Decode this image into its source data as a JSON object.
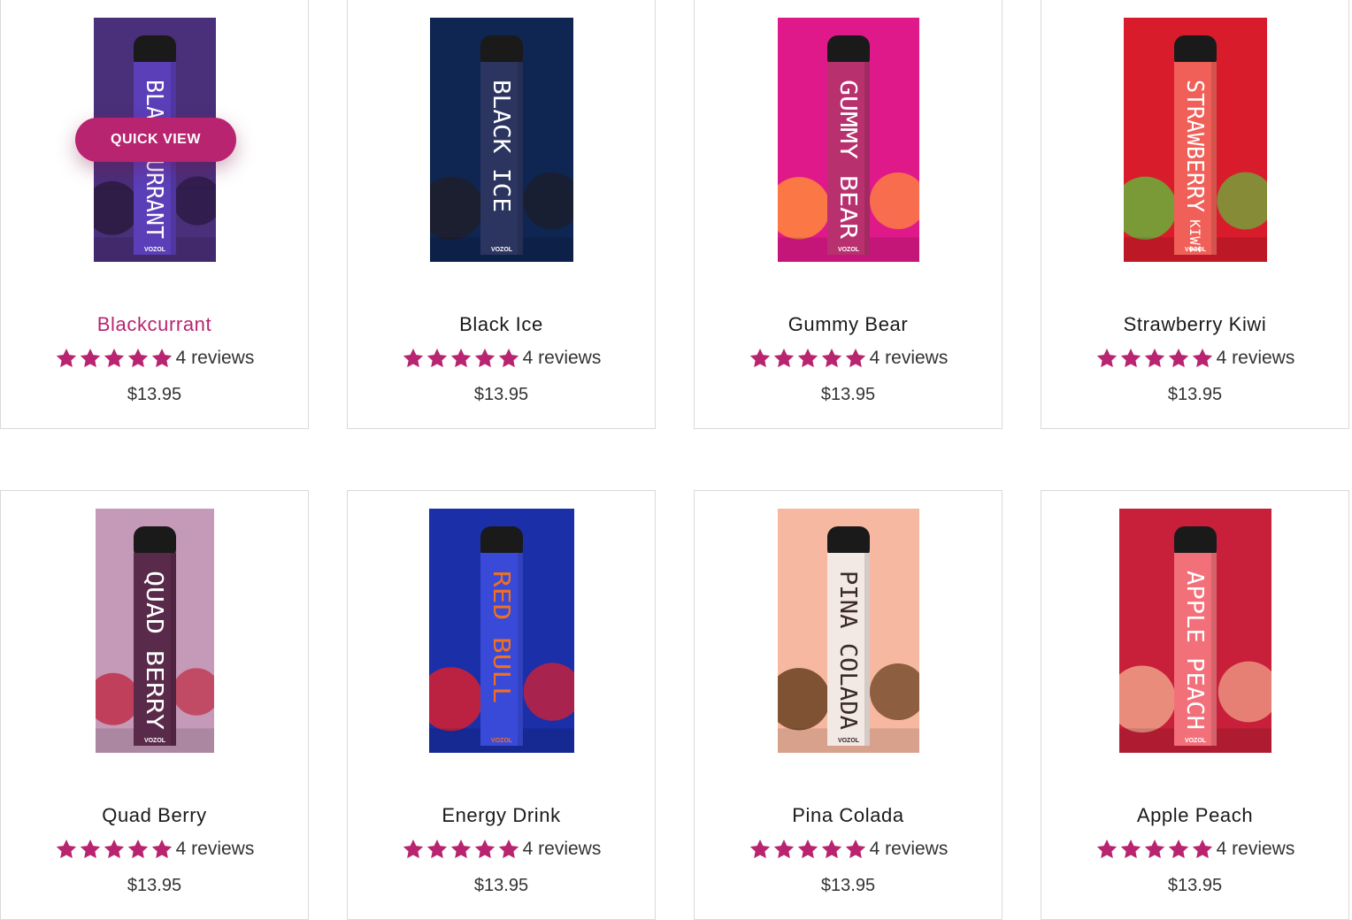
{
  "quick_view_label": "QUICK VIEW",
  "accent_color": "#b8246f",
  "rating_value": 5,
  "products": [
    {
      "name": "Blackcurrant",
      "reviews": "4 reviews",
      "price": "$13.95",
      "pen_text": "BLACKCURRANT",
      "brand": "VOZOL",
      "bg": "#4a2f7a",
      "pen": "#5a3fb8",
      "text_color": "#ffffff",
      "accent": "#2a1a40",
      "highlighted": true
    },
    {
      "name": "Black Ice",
      "reviews": "4 reviews",
      "price": "$13.95",
      "pen_text": "BLACK ICE",
      "brand": "VOZOL",
      "bg": "#0f2552",
      "pen": "#2b3560",
      "text_color": "#ffffff",
      "accent": "#1e1e2a",
      "highlighted": false
    },
    {
      "name": "Gummy Bear",
      "reviews": "4 reviews",
      "price": "$13.95",
      "pen_text": "GUMMY BEAR",
      "brand": "VOZOL",
      "bg": "#e0198a",
      "pen": "#b8306e",
      "text_color": "#ffffff",
      "accent": "#ff8a3a",
      "highlighted": false
    },
    {
      "name": "Strawberry Kiwi",
      "reviews": "4 reviews",
      "price": "$13.95",
      "pen_text": "STRAWBERRY",
      "pen_sub": "KIWI",
      "brand": "VOZOL",
      "bg": "#d81c2c",
      "pen": "#f06058",
      "text_color": "#ffffff",
      "accent": "#6ab03a",
      "highlighted": false
    },
    {
      "name": "Quad Berry",
      "reviews": "4 reviews",
      "price": "$13.95",
      "pen_text": "QUAD BERRY",
      "brand": "VOZOL",
      "bg": "#c49ab8",
      "pen": "#5a2a4a",
      "text_color": "#ffffff",
      "accent": "#c0304a",
      "highlighted": false
    },
    {
      "name": "Energy Drink",
      "reviews": "4 reviews",
      "price": "$13.95",
      "pen_text": "RED BULL",
      "brand": "VOZOL",
      "bg": "#1a2fa8",
      "pen": "#3a4ad8",
      "text_color": "#f07020",
      "accent": "#d82030",
      "highlighted": false
    },
    {
      "name": "Pina Colada",
      "reviews": "4 reviews",
      "price": "$13.95",
      "pen_text": "PINA COLADA",
      "brand": "VOZOL",
      "bg": "#f6b8a0",
      "pen": "#f2e8e4",
      "text_color": "#3a2a26",
      "accent": "#6a4020",
      "highlighted": false
    },
    {
      "name": "Apple Peach",
      "reviews": "4 reviews",
      "price": "$13.95",
      "pen_text": "APPLE PEACH",
      "brand": "VOZOL",
      "bg": "#c8203a",
      "pen": "#f2707a",
      "text_color": "#ffffff",
      "accent": "#f0a088",
      "highlighted": false
    }
  ]
}
